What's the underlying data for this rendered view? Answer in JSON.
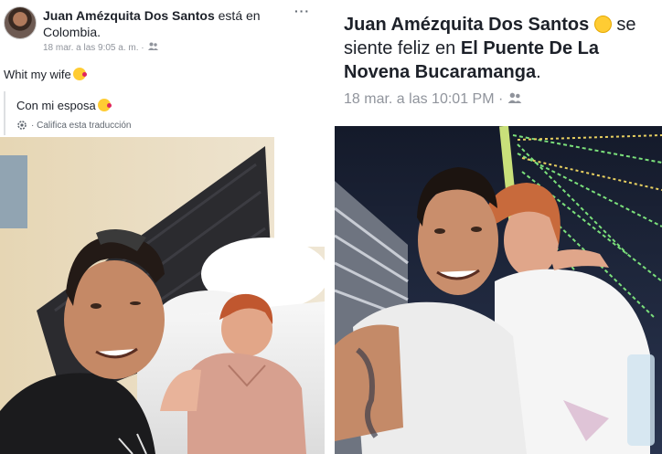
{
  "left_post": {
    "author": "Juan Amézquita Dos Santos",
    "location_text": "está en Colombia.",
    "timestamp": "18 mar. a las 9:05 a. m. ·",
    "audience_icon": "friends-icon",
    "menu_icon": "more-dots-icon",
    "menu_label": "···",
    "text": "Whit my wife",
    "translation": {
      "text": "Con mi esposa",
      "rate_label": "· Califica esta traducción",
      "icon": "gear-icon"
    },
    "emoji": "face-blowing-kiss-icon"
  },
  "right_post": {
    "author": "Juan Amézquita Dos Santos",
    "feeling_prefix": "se siente feliz en",
    "place": "El Puente De La Novena Bucaramanga",
    "period": ".",
    "feeling_icon": "smiley-icon",
    "timestamp": "18 mar. a las 10:01 PM ·",
    "audience_icon": "friends-icon"
  },
  "colors": {
    "name_text": "#1d2129",
    "meta_text": "#90949c",
    "bed_headboard": "#2b2b2f",
    "wall": "#e8dcc4",
    "night_sky": "#1a1f2e",
    "bridge_lights": "#7be07b"
  }
}
